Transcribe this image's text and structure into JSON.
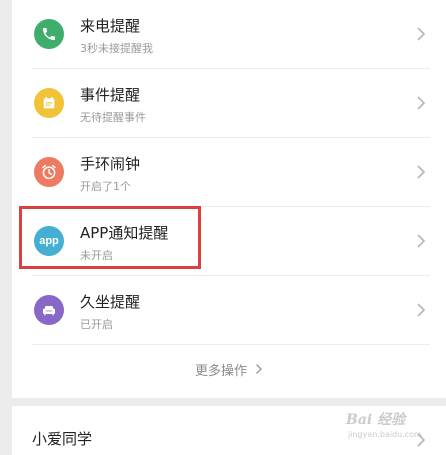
{
  "settings": {
    "items": [
      {
        "title": "来电提醒",
        "subtitle": "3秒未接提醒我",
        "icon": "phone-icon",
        "color": "#3fae6c"
      },
      {
        "title": "事件提醒",
        "subtitle": "无待提醒事件",
        "icon": "calendar-icon",
        "color": "#f0c338"
      },
      {
        "title": "手环闹钟",
        "subtitle": "开启了1个",
        "icon": "alarm-clock-icon",
        "color": "#ee7a62"
      },
      {
        "title": "APP通知提醒",
        "subtitle": "未开启",
        "icon": "app-icon",
        "icon_text": "app",
        "color": "#45aed3"
      },
      {
        "title": "久坐提醒",
        "subtitle": "已开启",
        "icon": "sofa-icon",
        "color": "#8868c7"
      }
    ],
    "more_label": "更多操作"
  },
  "second_section": {
    "title": "小爱同学"
  },
  "highlight": {
    "color": "#d9413f"
  },
  "watermark": {
    "text": "Bai 经验",
    "sub": "jingyan.baidu.com"
  }
}
